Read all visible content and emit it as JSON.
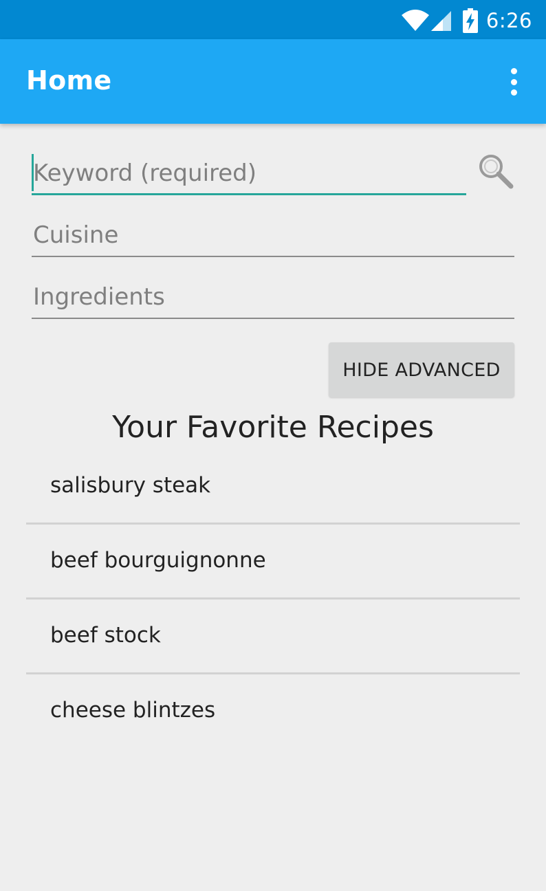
{
  "status_bar": {
    "time": "6:26",
    "icons": [
      "wifi-icon",
      "cell-signal-icon",
      "battery-charging-icon"
    ]
  },
  "app_bar": {
    "title": "Home",
    "menu_icon": "overflow-menu-icon"
  },
  "search_form": {
    "keyword_placeholder": "Keyword (required)",
    "keyword_value": "",
    "cuisine_placeholder": "Cuisine",
    "cuisine_value": "",
    "ingredients_placeholder": "Ingredients",
    "ingredients_value": "",
    "search_icon": "search-icon",
    "hide_advanced_label": "HIDE ADVANCED"
  },
  "favorites": {
    "title": "Your Favorite Recipes",
    "items": [
      {
        "label": "salisbury steak"
      },
      {
        "label": "beef bourguignonne"
      },
      {
        "label": "beef stock"
      },
      {
        "label": "cheese blintzes"
      }
    ]
  },
  "colors": {
    "status_bar": "#0288d1",
    "app_bar": "#1ea8f4",
    "accent": "#26a69a",
    "background": "#eeeeee",
    "button": "#d6d7d7"
  }
}
